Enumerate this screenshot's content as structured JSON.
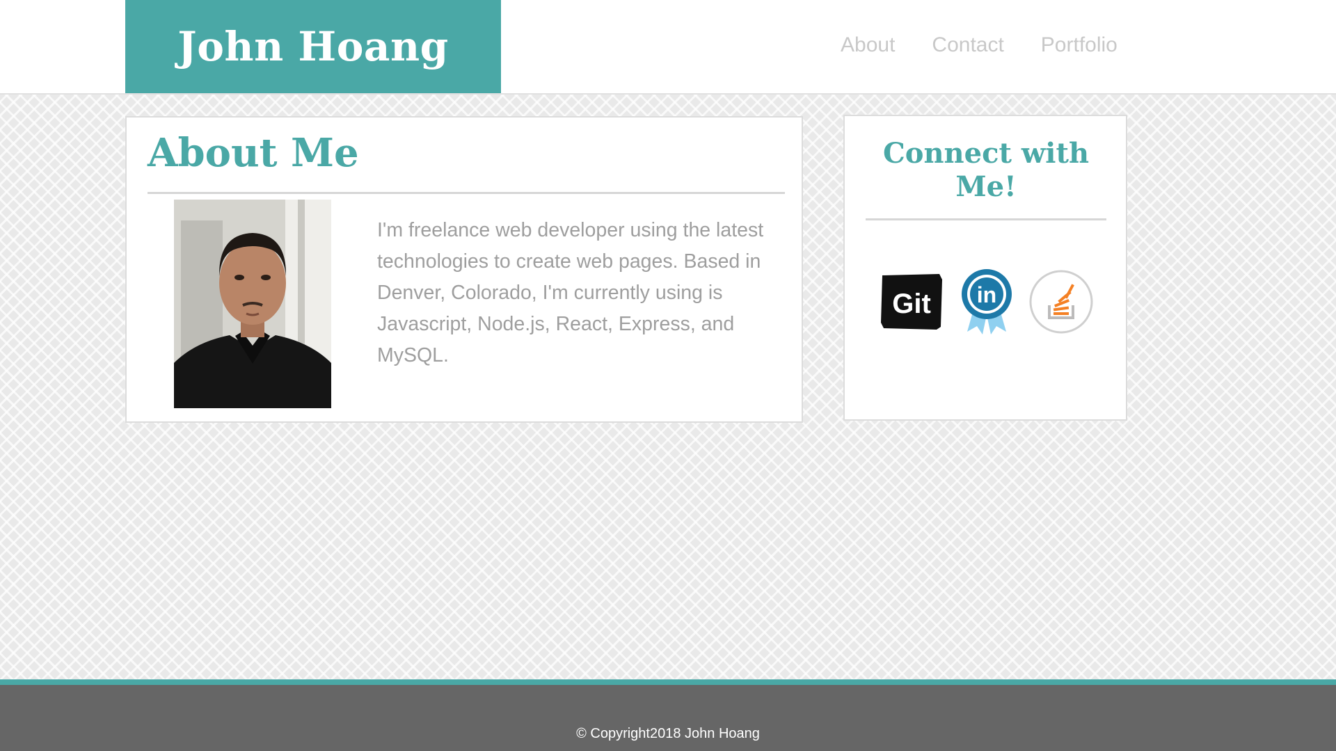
{
  "header": {
    "brand": "John Hoang",
    "nav": [
      "About",
      "Contact",
      "Portfolio"
    ]
  },
  "about": {
    "title": "About Me",
    "bio": "I'm freelance web developer using the latest technologies to create web pages. Based in Denver, Colorado, I'm currently using is Javascript, Node.js, React, Express, and MySQL."
  },
  "connect": {
    "title": "Connect with Me!",
    "links": [
      {
        "name": "Git",
        "icon": "git-icon"
      },
      {
        "name": "LinkedIn",
        "icon": "linkedin-icon"
      },
      {
        "name": "Stack Overflow",
        "icon": "stackoverflow-icon"
      }
    ]
  },
  "footer": {
    "copyright": "© Copyright2018 John Hoang"
  },
  "colors": {
    "accent": "#4aa8a6",
    "footer": "#666666",
    "text_muted": "#9e9e9e"
  }
}
